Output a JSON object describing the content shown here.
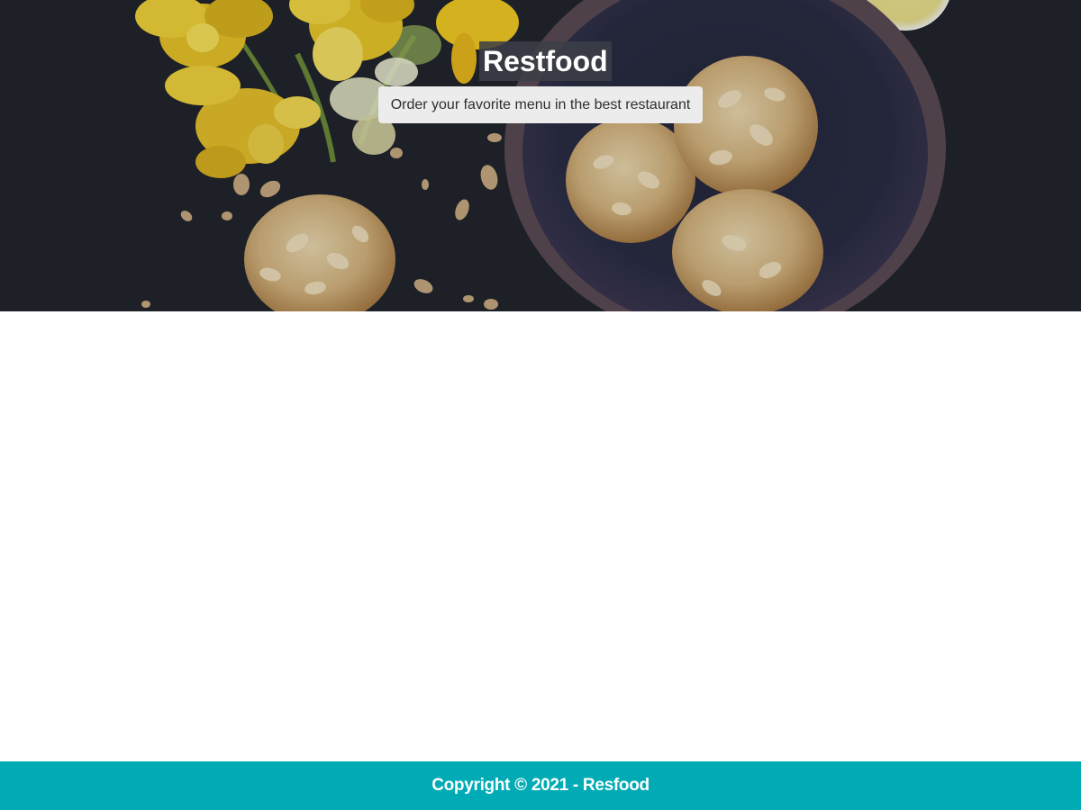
{
  "hero": {
    "title": "Restfood",
    "subtitle": "Order your favorite menu in the best restaurant",
    "background_image": "food-photo-almond-cookies-daffodils"
  },
  "footer": {
    "copyright": "Copyright © 2021 - Resfood"
  },
  "colors": {
    "footer_background": "#00abb5",
    "hero_background": "#22252c",
    "subtitle_background": "#ececec"
  }
}
